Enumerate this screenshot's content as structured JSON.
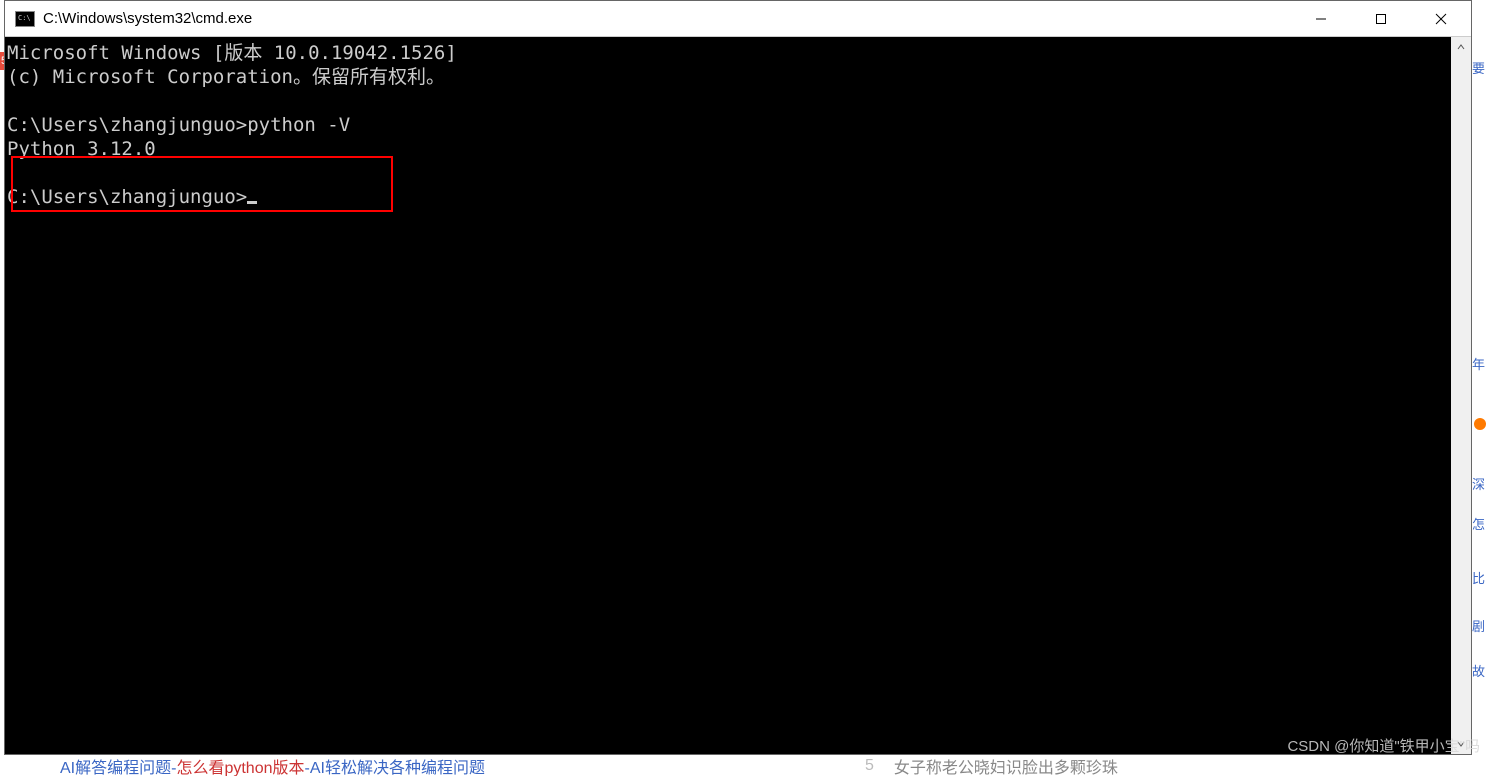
{
  "window": {
    "title": "C:\\Windows\\system32\\cmd.exe",
    "icon_text": "C:\\"
  },
  "terminal": {
    "line1": "Microsoft Windows [版本 10.0.19042.1526]",
    "line2": "(c) Microsoft Corporation。保留所有权利。",
    "blank1": "",
    "prompt1": "C:\\Users\\zhangjunguo>python -V",
    "output1": "Python 3.12.0",
    "blank2": "",
    "prompt2": "C:\\Users\\zhangjunguo>"
  },
  "right_strip": {
    "item1": "要",
    "item3": "年",
    "item4": "深",
    "item5": "怎",
    "item6": "比",
    "item7": "剧",
    "item8": "故"
  },
  "bottom": {
    "part1": "AI解答编程问题-",
    "part2": "怎么看python版本",
    "part3": "-AI轻松解决各种编程问题",
    "part4": "女子称老公晓妇识脸出多颗珍珠",
    "num": "5"
  },
  "watermark": "CSDN @你知道\"铁甲小宝\"吗"
}
